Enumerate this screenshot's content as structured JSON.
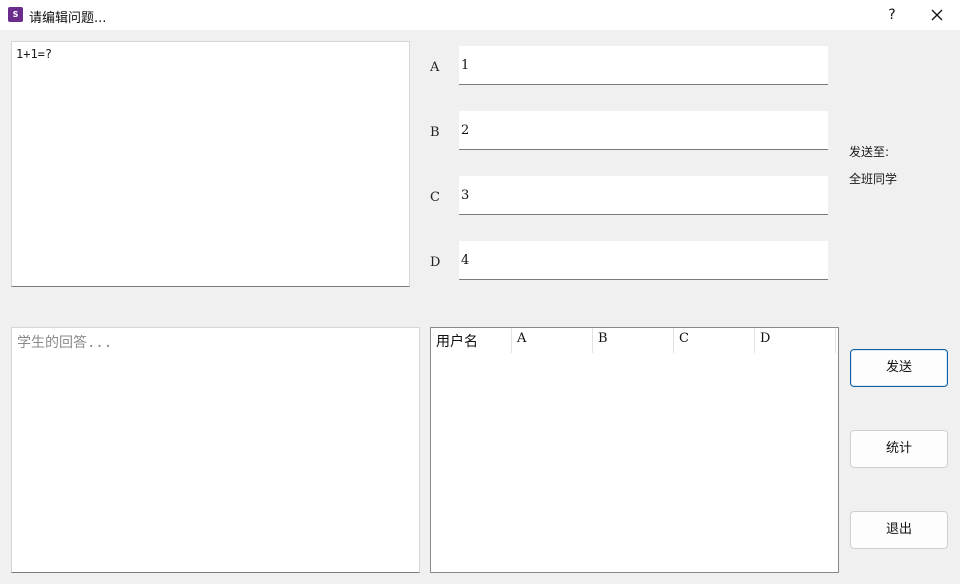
{
  "window": {
    "title": "请编辑问题...",
    "app_icon_glyph": "S",
    "help_label": "?",
    "accent_color": "#6b2d8c"
  },
  "question": {
    "text": "1+1=?"
  },
  "options": [
    {
      "label": "A",
      "value": "1"
    },
    {
      "label": "B",
      "value": "2"
    },
    {
      "label": "C",
      "value": "3"
    },
    {
      "label": "D",
      "value": "4"
    }
  ],
  "send_to": {
    "label": "发送至:",
    "value": "全班同学"
  },
  "answers": {
    "placeholder": "学生的回答..."
  },
  "table": {
    "headers": [
      "用户名",
      "A",
      "B",
      "C",
      "D"
    ],
    "rows": []
  },
  "buttons": {
    "send": "发送",
    "stats": "统计",
    "exit": "退出"
  }
}
